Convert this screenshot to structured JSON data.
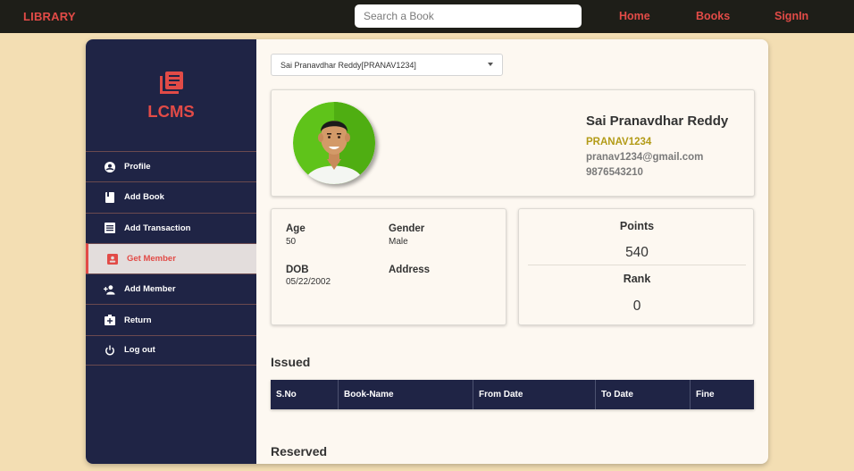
{
  "header": {
    "brand": "LIBRARY",
    "search_placeholder": "Search a Book",
    "nav": {
      "home": "Home",
      "books": "Books",
      "signin": "SignIn"
    }
  },
  "sidebar": {
    "logo_text": "LCMS",
    "items": [
      {
        "label": "Profile",
        "icon": "account-circle-icon"
      },
      {
        "label": "Add Book",
        "icon": "book-icon"
      },
      {
        "label": "Add Transaction",
        "icon": "list-icon"
      },
      {
        "label": "Get Member",
        "icon": "badge-icon",
        "active": true
      },
      {
        "label": "Add Member",
        "icon": "person-add-icon"
      },
      {
        "label": "Return",
        "icon": "return-box-icon"
      },
      {
        "label": "Log out",
        "icon": "power-icon"
      }
    ]
  },
  "member_select": {
    "value": "Sai Pranavdhar Reddy[PRANAV1234]"
  },
  "profile": {
    "name": "Sai Pranavdhar Reddy",
    "id": "PRANAV1234",
    "email": "pranav1234@gmail.com",
    "phone": "9876543210"
  },
  "details": {
    "age_label": "Age",
    "age": "50",
    "gender_label": "Gender",
    "gender": "Male",
    "dob_label": "DOB",
    "dob": "05/22/2002",
    "address_label": "Address",
    "address": ""
  },
  "stats": {
    "points_label": "Points",
    "points": "540",
    "rank_label": "Rank",
    "rank": "0"
  },
  "issued": {
    "title": "Issued",
    "columns": [
      "S.No",
      "Book-Name",
      "From Date",
      "To Date",
      "Fine"
    ]
  },
  "reserved": {
    "title": "Reserved"
  },
  "colors": {
    "accent": "#e24b47",
    "navy": "#1f2445",
    "page_bg": "#f3deb3",
    "topbar": "#1e1e18",
    "member_id": "#b39b17"
  }
}
